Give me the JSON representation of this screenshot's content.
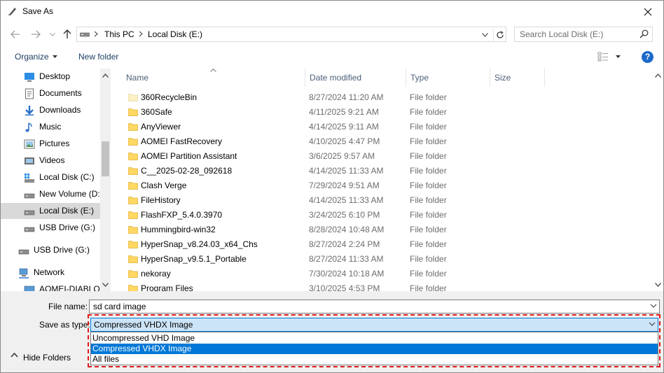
{
  "window": {
    "title": "Save As"
  },
  "address": {
    "crumbs": [
      "This PC",
      "Local Disk (E:)"
    ],
    "search_placeholder": "Search Local Disk (E:)"
  },
  "toolbar": {
    "organize": "Organize",
    "new_folder": "New folder",
    "help": "?"
  },
  "nav": {
    "items": [
      {
        "label": "Desktop",
        "icon": "desktop-icon"
      },
      {
        "label": "Documents",
        "icon": "documents-icon"
      },
      {
        "label": "Downloads",
        "icon": "downloads-icon"
      },
      {
        "label": "Music",
        "icon": "music-icon"
      },
      {
        "label": "Pictures",
        "icon": "pictures-icon"
      },
      {
        "label": "Videos",
        "icon": "videos-icon"
      },
      {
        "label": "Local Disk (C:)",
        "icon": "windows-drive-icon"
      },
      {
        "label": "New Volume (D:)",
        "icon": "drive-icon"
      },
      {
        "label": "Local Disk (E:)",
        "icon": "drive-icon",
        "selected": true
      },
      {
        "label": "USB Drive (G:)",
        "icon": "usb-drive-icon"
      },
      {
        "label": "USB Drive (G:)",
        "icon": "usb-drive-icon"
      },
      {
        "label": "Network",
        "icon": "network-icon"
      },
      {
        "label": "AOMEI-DIABLOS",
        "icon": "computer-icon"
      }
    ]
  },
  "list": {
    "columns": [
      "Name",
      "Date modified",
      "Type",
      "Size"
    ],
    "rows": [
      {
        "name": "360RecycleBin",
        "date": "8/27/2024 11:20 AM",
        "type": "File folder",
        "faded": true
      },
      {
        "name": "360Safe",
        "date": "4/11/2025 9:21 AM",
        "type": "File folder"
      },
      {
        "name": "AnyViewer",
        "date": "4/14/2025 9:11 AM",
        "type": "File folder"
      },
      {
        "name": "AOMEI FastRecovery",
        "date": "4/10/2025 4:47 PM",
        "type": "File folder"
      },
      {
        "name": "AOMEI Partition Assistant",
        "date": "3/6/2025 9:57 AM",
        "type": "File folder"
      },
      {
        "name": "C__2025-02-28_092618",
        "date": "4/14/2025 11:33 AM",
        "type": "File folder"
      },
      {
        "name": "Clash Verge",
        "date": "7/29/2024 9:51 AM",
        "type": "File folder"
      },
      {
        "name": "FileHistory",
        "date": "4/14/2025 11:33 AM",
        "type": "File folder"
      },
      {
        "name": "FlashFXP_5.4.0.3970",
        "date": "3/24/2025 6:10 PM",
        "type": "File folder"
      },
      {
        "name": "Hummingbird-win32",
        "date": "8/28/2024 10:48 AM",
        "type": "File folder"
      },
      {
        "name": "HyperSnap_v8.24.03_x64_Chs",
        "date": "8/27/2024 2:24 PM",
        "type": "File folder"
      },
      {
        "name": "HyperSnap_v9.5.1_Portable",
        "date": "8/27/2024 11:33 AM",
        "type": "File folder"
      },
      {
        "name": "nekoray",
        "date": "7/30/2024 10:18 AM",
        "type": "File folder"
      },
      {
        "name": "Program Files",
        "date": "3/10/2025 4:53 PM",
        "type": "File folder"
      }
    ]
  },
  "form": {
    "file_name_label": "File name:",
    "file_name_value": "sd card image",
    "save_as_type_label": "Save as type:",
    "save_as_type_value": "Compressed VHDX Image",
    "options": [
      "Uncompressed VHD Image",
      "Compressed VHDX Image",
      "All files"
    ],
    "selected_option_index": 1,
    "hide_folders": "Hide Folders"
  },
  "colors": {
    "accent": "#0078d7",
    "highlight": "#e01919",
    "folder": "#ffd864"
  }
}
